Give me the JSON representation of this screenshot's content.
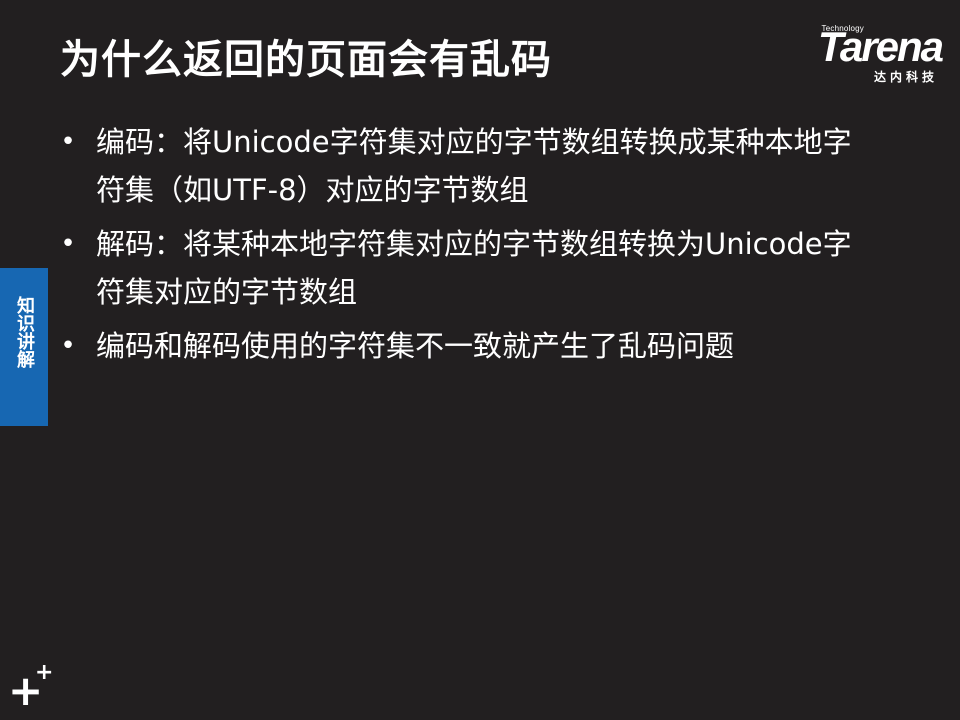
{
  "slide": {
    "title": "为什么返回的页面会有乱码",
    "section_label": "知识讲解",
    "bullets": [
      {
        "marker": "•",
        "text": "编码：将Unicode字符集对应的字节数组转换成某种本地字符集（如UTF-8）对应的字节数组"
      },
      {
        "marker": "•",
        "text": "解码：将某种本地字符集对应的字节数组转换为Unicode字符集对应的字节数组"
      },
      {
        "marker": "•",
        "text": "编码和解码使用的字符集不一致就产生了乱码问题"
      }
    ]
  },
  "logo": {
    "tagline": "Technology",
    "wordmark": "Tarena",
    "subtitle": "达内科技"
  },
  "corner_mark": {
    "big": "+",
    "small": "+"
  },
  "colors": {
    "background": "#221f20",
    "text": "#ffffff",
    "badge": "#1767b2"
  }
}
